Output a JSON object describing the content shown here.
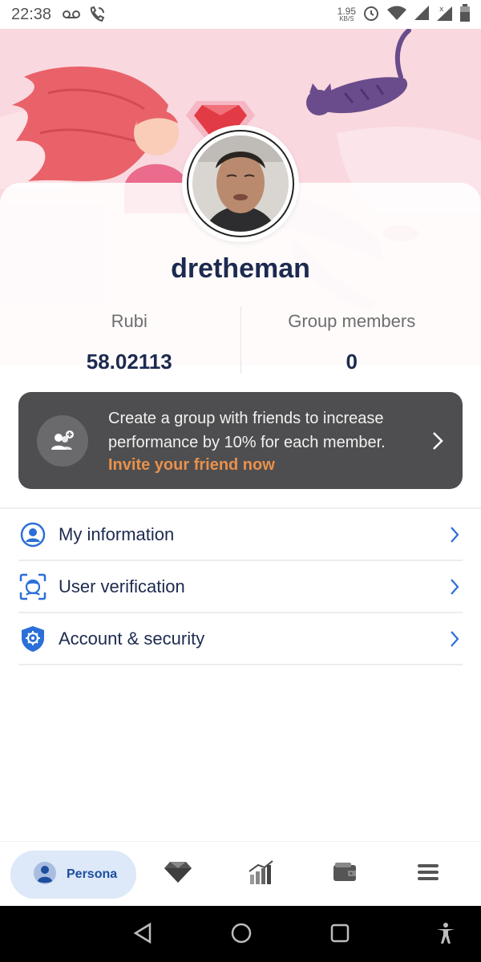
{
  "status_bar": {
    "time": "22:38",
    "net_speed_value": "1.95",
    "net_speed_unit": "KB/S",
    "icons": [
      "voicemail-icon",
      "wifi-call-icon",
      "alarm-icon",
      "wifi-icon",
      "signal-icon",
      "signal-x-icon",
      "battery-icon"
    ]
  },
  "profile": {
    "username": "dretheman",
    "stats": [
      {
        "label": "Rubi",
        "value": "58.02113"
      },
      {
        "label": "Group members",
        "value": "0"
      }
    ]
  },
  "invite_banner": {
    "description": "Create a group with friends to increase performance by 10% for each member.",
    "link_text": "Invite your friend now"
  },
  "menu": [
    {
      "label": "My information",
      "icon": "user-circle-icon"
    },
    {
      "label": "User verification",
      "icon": "face-scan-icon"
    },
    {
      "label": "Account & security",
      "icon": "shield-gear-icon"
    }
  ],
  "bottom_nav": {
    "active_label": "Persona",
    "items": [
      "persona-icon",
      "diamond-icon",
      "chart-icon",
      "wallet-icon",
      "menu-icon"
    ]
  },
  "colors": {
    "brand_navy": "#1d2a4f",
    "accent_blue": "#2b6fd8",
    "invite_bg": "#4e4e50",
    "invite_link": "#e9914b",
    "hero_pink": "#f9d8df"
  }
}
